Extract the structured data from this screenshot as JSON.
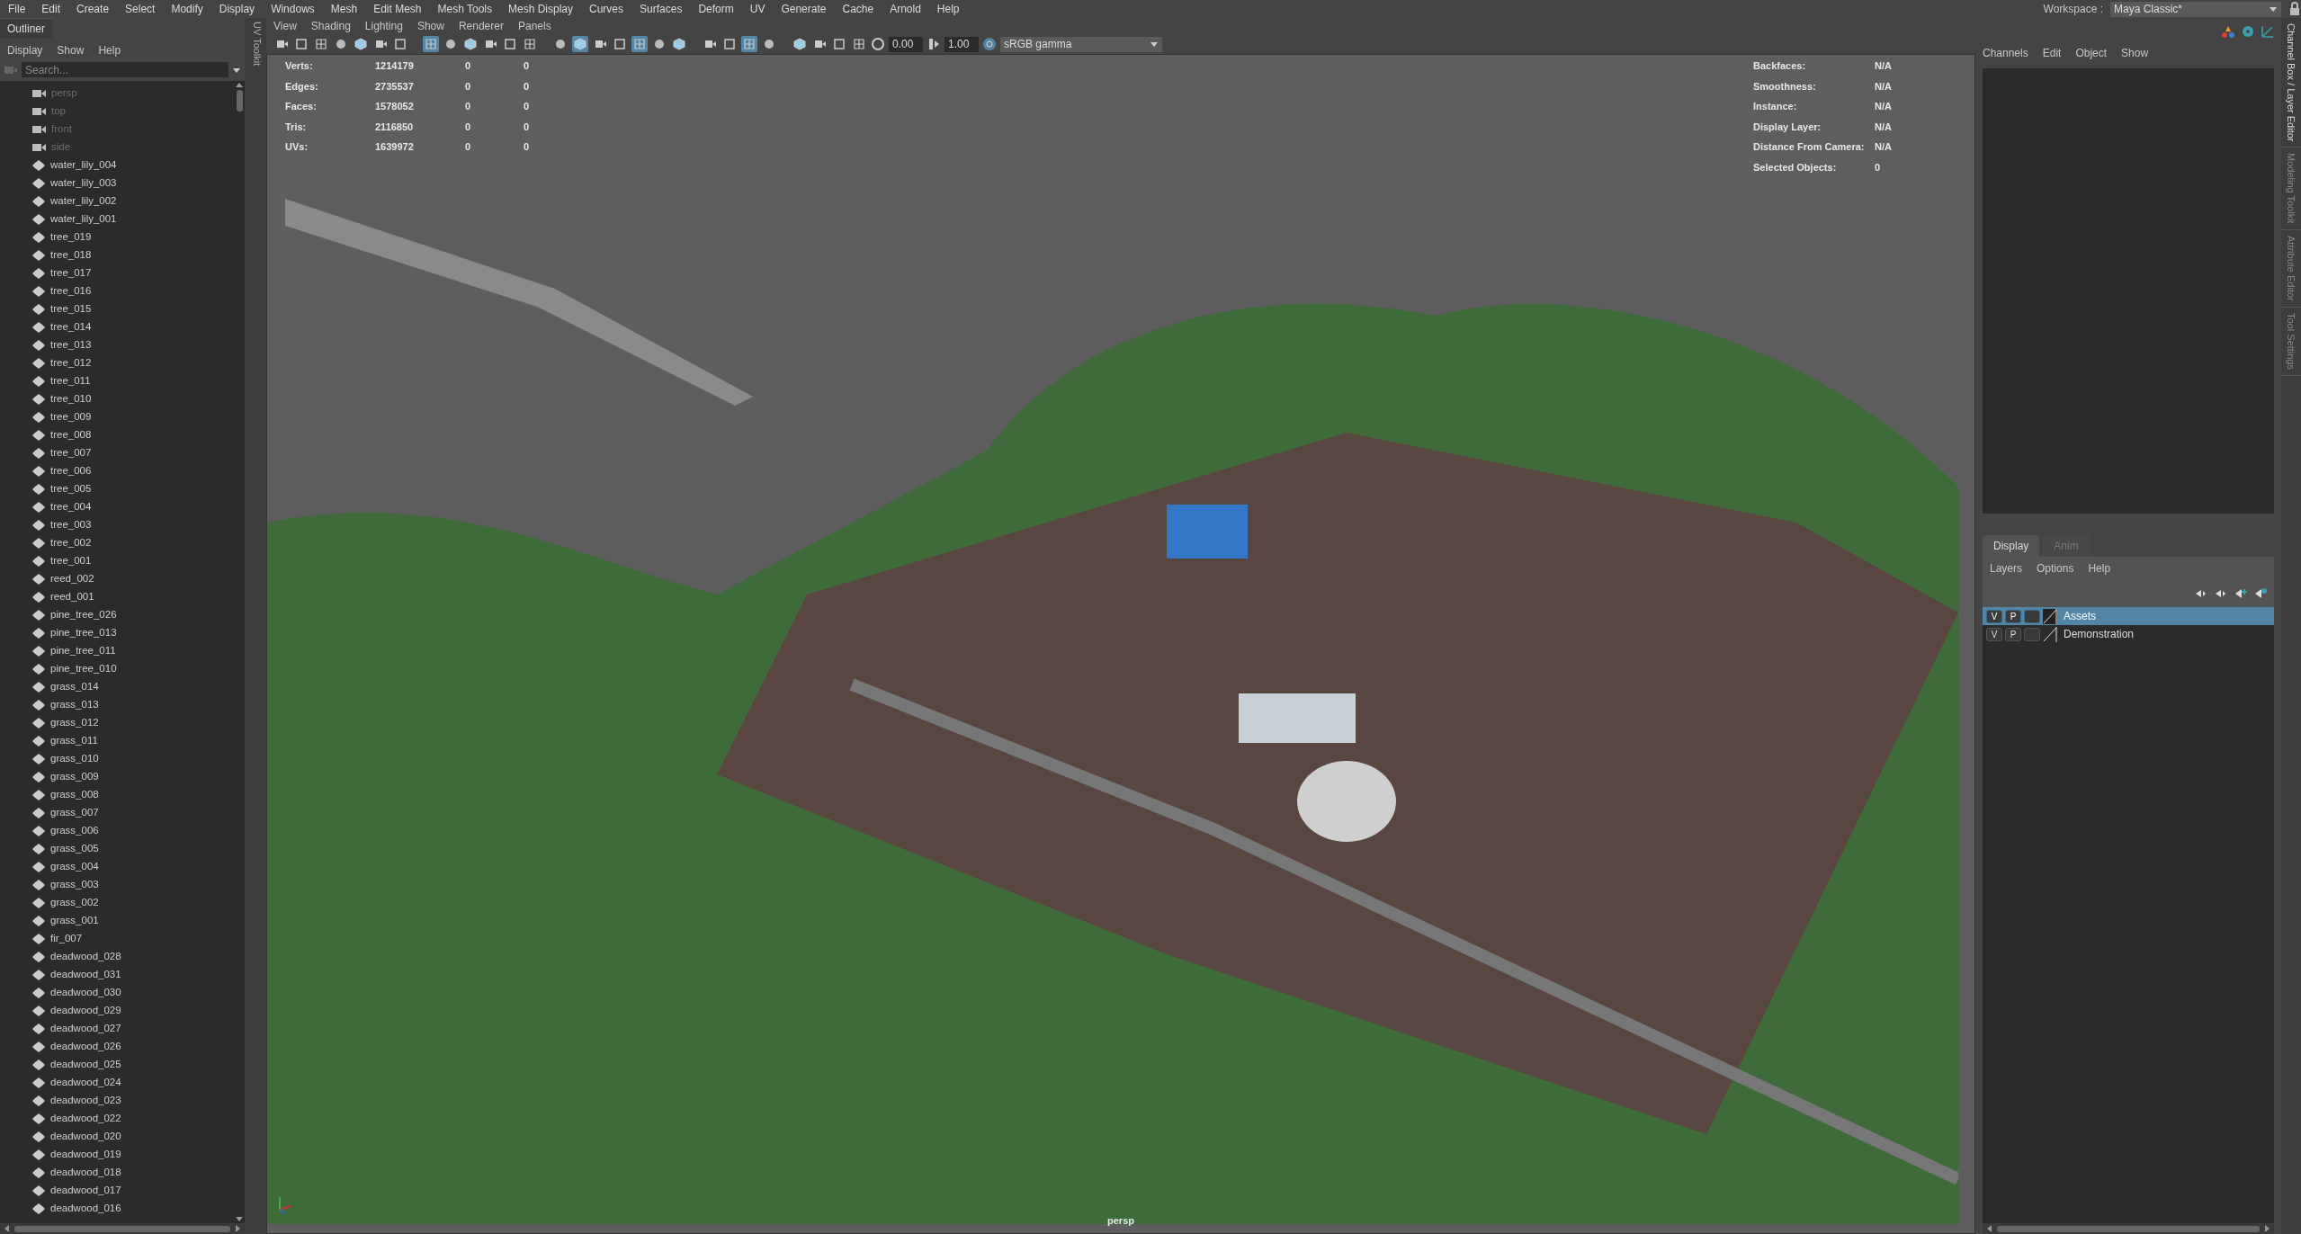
{
  "menu_bar": {
    "items": [
      "File",
      "Edit",
      "Create",
      "Select",
      "Modify",
      "Display",
      "Windows",
      "Mesh",
      "Edit Mesh",
      "Mesh Tools",
      "Mesh Display",
      "Curves",
      "Surfaces",
      "Deform",
      "UV",
      "Generate",
      "Cache",
      "Arnold",
      "Help"
    ],
    "workspace_label": "Workspace :",
    "workspace": "Maya Classic*"
  },
  "outliner": {
    "title": "Outliner",
    "menu": [
      "Display",
      "Show",
      "Help"
    ],
    "search": {
      "placeholder": "Search..."
    },
    "items": [
      {
        "name": "persp",
        "kind": "camera"
      },
      {
        "name": "top",
        "kind": "camera"
      },
      {
        "name": "front",
        "kind": "camera"
      },
      {
        "name": "side",
        "kind": "camera"
      },
      {
        "name": "water_lily_004",
        "kind": "mesh"
      },
      {
        "name": "water_lily_003",
        "kind": "mesh"
      },
      {
        "name": "water_lily_002",
        "kind": "mesh"
      },
      {
        "name": "water_lily_001",
        "kind": "mesh"
      },
      {
        "name": "tree_019",
        "kind": "mesh"
      },
      {
        "name": "tree_018",
        "kind": "mesh"
      },
      {
        "name": "tree_017",
        "kind": "mesh"
      },
      {
        "name": "tree_016",
        "kind": "mesh"
      },
      {
        "name": "tree_015",
        "kind": "mesh"
      },
      {
        "name": "tree_014",
        "kind": "mesh"
      },
      {
        "name": "tree_013",
        "kind": "mesh"
      },
      {
        "name": "tree_012",
        "kind": "mesh"
      },
      {
        "name": "tree_011",
        "kind": "mesh"
      },
      {
        "name": "tree_010",
        "kind": "mesh"
      },
      {
        "name": "tree_009",
        "kind": "mesh"
      },
      {
        "name": "tree_008",
        "kind": "mesh"
      },
      {
        "name": "tree_007",
        "kind": "mesh"
      },
      {
        "name": "tree_006",
        "kind": "mesh"
      },
      {
        "name": "tree_005",
        "kind": "mesh"
      },
      {
        "name": "tree_004",
        "kind": "mesh"
      },
      {
        "name": "tree_003",
        "kind": "mesh"
      },
      {
        "name": "tree_002",
        "kind": "mesh"
      },
      {
        "name": "tree_001",
        "kind": "mesh"
      },
      {
        "name": "reed_002",
        "kind": "mesh"
      },
      {
        "name": "reed_001",
        "kind": "mesh"
      },
      {
        "name": "pine_tree_026",
        "kind": "mesh"
      },
      {
        "name": "pine_tree_013",
        "kind": "mesh"
      },
      {
        "name": "pine_tree_011",
        "kind": "mesh"
      },
      {
        "name": "pine_tree_010",
        "kind": "mesh"
      },
      {
        "name": "grass_014",
        "kind": "mesh"
      },
      {
        "name": "grass_013",
        "kind": "mesh"
      },
      {
        "name": "grass_012",
        "kind": "mesh"
      },
      {
        "name": "grass_011",
        "kind": "mesh"
      },
      {
        "name": "grass_010",
        "kind": "mesh"
      },
      {
        "name": "grass_009",
        "kind": "mesh"
      },
      {
        "name": "grass_008",
        "kind": "mesh"
      },
      {
        "name": "grass_007",
        "kind": "mesh"
      },
      {
        "name": "grass_006",
        "kind": "mesh"
      },
      {
        "name": "grass_005",
        "kind": "mesh"
      },
      {
        "name": "grass_004",
        "kind": "mesh"
      },
      {
        "name": "grass_003",
        "kind": "mesh"
      },
      {
        "name": "grass_002",
        "kind": "mesh"
      },
      {
        "name": "grass_001",
        "kind": "mesh"
      },
      {
        "name": "fir_007",
        "kind": "mesh"
      },
      {
        "name": "deadwood_028",
        "kind": "mesh"
      },
      {
        "name": "deadwood_031",
        "kind": "mesh"
      },
      {
        "name": "deadwood_030",
        "kind": "mesh"
      },
      {
        "name": "deadwood_029",
        "kind": "mesh"
      },
      {
        "name": "deadwood_027",
        "kind": "mesh"
      },
      {
        "name": "deadwood_026",
        "kind": "mesh"
      },
      {
        "name": "deadwood_025",
        "kind": "mesh"
      },
      {
        "name": "deadwood_024",
        "kind": "mesh"
      },
      {
        "name": "deadwood_023",
        "kind": "mesh"
      },
      {
        "name": "deadwood_022",
        "kind": "mesh"
      },
      {
        "name": "deadwood_020",
        "kind": "mesh"
      },
      {
        "name": "deadwood_019",
        "kind": "mesh"
      },
      {
        "name": "deadwood_018",
        "kind": "mesh"
      },
      {
        "name": "deadwood_017",
        "kind": "mesh"
      },
      {
        "name": "deadwood_016",
        "kind": "mesh"
      }
    ]
  },
  "side_tab": "UV Toolkit",
  "viewport": {
    "menu": [
      "View",
      "Shading",
      "Lighting",
      "Show",
      "Renderer",
      "Panels"
    ],
    "toolbar_icons": [
      {
        "selected": false
      },
      {
        "selected": false
      },
      {
        "selected": false
      },
      {
        "selected": false
      },
      {
        "selected": false
      },
      {
        "selected": false
      },
      {
        "selected": false
      },
      {
        "selected": true
      },
      {
        "selected": false
      },
      {
        "selected": false
      },
      {
        "selected": false
      },
      {
        "selected": false
      },
      {
        "selected": false
      },
      {
        "selected": false
      },
      {
        "selected": true
      },
      {
        "selected": false
      },
      {
        "selected": false
      },
      {
        "selected": true
      },
      {
        "selected": false
      },
      {
        "selected": false
      },
      {
        "selected": false
      },
      {
        "selected": false
      },
      {
        "selected": true
      },
      {
        "selected": false
      },
      {
        "selected": false
      },
      {
        "selected": false
      },
      {
        "selected": false
      },
      {
        "selected": false
      }
    ],
    "exposure": "0.00",
    "gamma": "1.00",
    "color_space": "sRGB gamma",
    "stats": [
      {
        "label": "Verts:",
        "value": "1214179",
        "col2": "0",
        "col3": "0"
      },
      {
        "label": "Edges:",
        "value": "2735537",
        "col2": "0",
        "col3": "0"
      },
      {
        "label": "Faces:",
        "value": "1578052",
        "col2": "0",
        "col3": "0"
      },
      {
        "label": "Tris:",
        "value": "2116850",
        "col2": "0",
        "col3": "0"
      },
      {
        "label": "UVs:",
        "value": "1639972",
        "col2": "0",
        "col3": "0"
      }
    ],
    "info": [
      {
        "label": "Backfaces:",
        "value": "N/A"
      },
      {
        "label": "Smoothness:",
        "value": "N/A"
      },
      {
        "label": "Instance:",
        "value": "N/A"
      },
      {
        "label": "Display Layer:",
        "value": "N/A"
      },
      {
        "label": "Distance From Camera:",
        "value": "N/A"
      },
      {
        "label": "Selected Objects:",
        "value": "0"
      }
    ],
    "camera_label": "persp"
  },
  "channel_box": {
    "menu": [
      "Channels",
      "Edit",
      "Object",
      "Show"
    ]
  },
  "layer_editor": {
    "tabs": [
      {
        "label": "Display",
        "selected": true
      },
      {
        "label": "Anim",
        "selected": false
      }
    ],
    "menu": [
      "Layers",
      "Options",
      "Help"
    ],
    "layers": [
      {
        "visible": "V",
        "playback": "P",
        "name": "Assets",
        "selected": true
      },
      {
        "visible": "V",
        "playback": "P",
        "name": "Demonstration",
        "selected": false
      }
    ]
  },
  "right_tabs": [
    {
      "label": "Channel Box / Layer Editor",
      "selected": true
    },
    {
      "label": "Modeling Toolkit",
      "selected": false
    },
    {
      "label": "Attribute Editor",
      "selected": false
    },
    {
      "label": "Tool Settings",
      "selected": false
    }
  ]
}
